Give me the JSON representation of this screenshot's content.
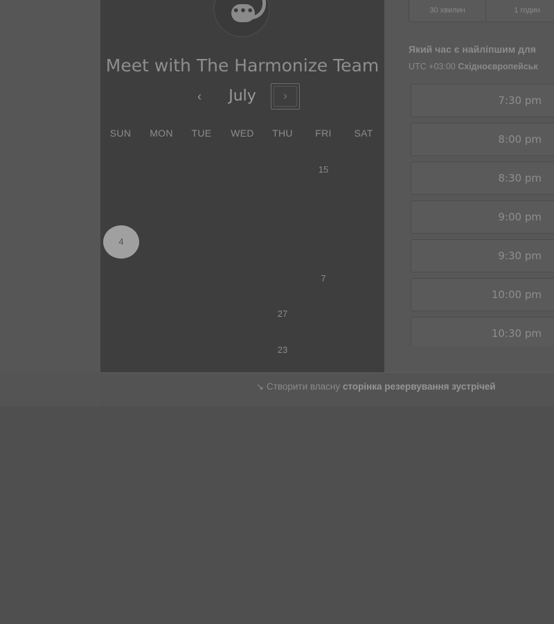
{
  "calendar": {
    "title": "Meet with The Harmonize Team",
    "logo_glyph": "•••",
    "prev_glyph": "‹",
    "next_glyph": "›",
    "month": "July",
    "weekdays": [
      "SUN",
      "MON",
      "TUE",
      "WED",
      "THU",
      "FRI",
      "SAT"
    ],
    "days": [
      {
        "label": "15",
        "col": 5,
        "row": 0
      },
      {
        "label": "4",
        "col": 0,
        "row": 2,
        "selected": true
      },
      {
        "label": "7",
        "col": 5,
        "row": 3
      },
      {
        "label": "27",
        "col": 4,
        "row": 4
      },
      {
        "label": "23",
        "col": 4,
        "row": 5
      }
    ]
  },
  "booking": {
    "durations": [
      "30 хвилин",
      "1 годин"
    ],
    "question": "Який час є найліпшим для",
    "timezone_prefix": "UTC +03:00",
    "timezone_name": "Східноєвропейськ",
    "slots": [
      "7:30 pm",
      "8:00 pm",
      "8:30 pm",
      "9:00 pm",
      "9:30 pm",
      "10:00 pm",
      "10:30 pm"
    ]
  },
  "footer": {
    "icon": "link-icon",
    "icon_glyph": "↘",
    "text_plain": "Створити власну",
    "text_bold": "сторінка резервування зустрічей"
  }
}
